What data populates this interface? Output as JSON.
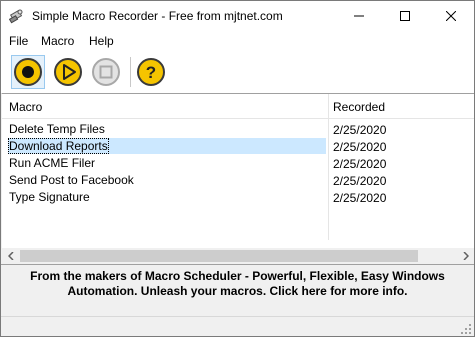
{
  "window": {
    "title": "Simple Macro Recorder - Free from mjtnet.com"
  },
  "menu": [
    {
      "label": "File"
    },
    {
      "label": "Macro"
    },
    {
      "label": "Help"
    }
  ],
  "toolbar": {
    "buttons": [
      {
        "icon": "record-icon"
      },
      {
        "icon": "play-icon"
      },
      {
        "icon": "stop-icon"
      },
      {
        "icon": "help-icon"
      }
    ]
  },
  "list": {
    "columns": [
      "Macro",
      "Recorded"
    ],
    "rows": [
      {
        "macro": "Delete Temp Files",
        "recorded": "2/25/2020"
      },
      {
        "macro": "Download Reports",
        "recorded": "2/25/2020",
        "selected": true
      },
      {
        "macro": "Run ACME Filer",
        "recorded": "2/25/2020"
      },
      {
        "macro": "Send Post to Facebook",
        "recorded": "2/25/2020"
      },
      {
        "macro": "Type Signature",
        "recorded": "2/25/2020"
      }
    ]
  },
  "banner": {
    "text": "From the makers of Macro Scheduler - Powerful, Flexible, Easy Windows Automation. Unleash your macros. Click here for more info."
  },
  "colors": {
    "selection": "#cce8ff",
    "record": "#f5c400",
    "play": "#f5c400",
    "help": "#f5c400"
  }
}
